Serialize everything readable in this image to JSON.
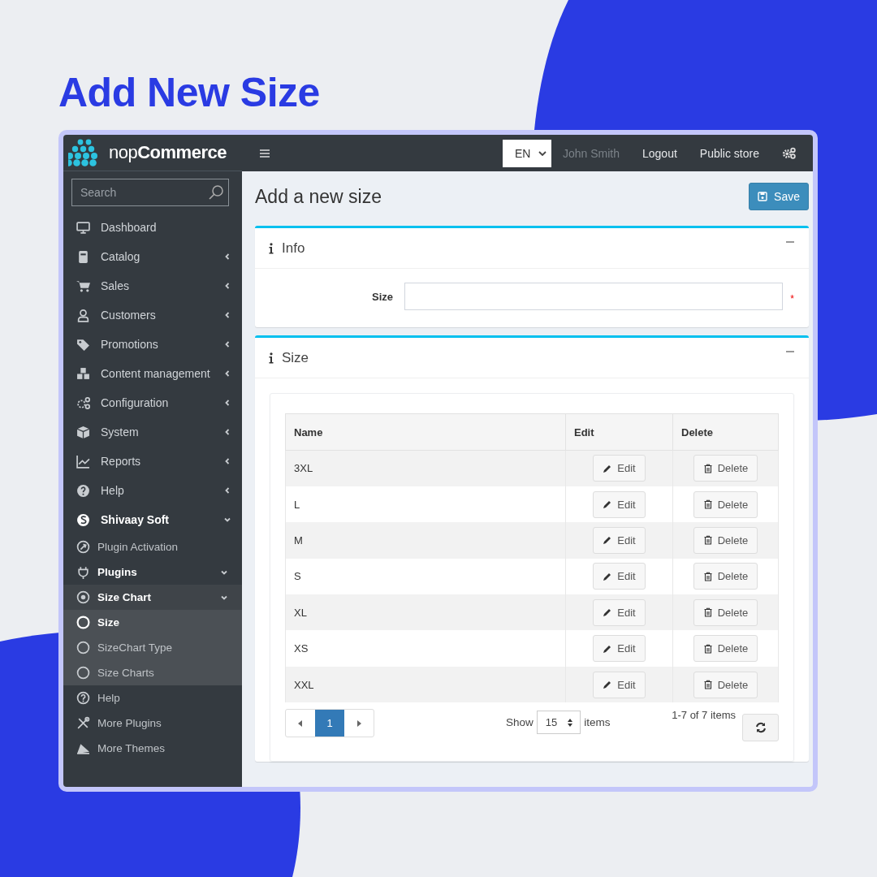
{
  "headline": "Add New Size",
  "logo": {
    "light": "nop",
    "bold": "Commerce"
  },
  "sidebar": {
    "search": {
      "placeholder": "Search"
    },
    "items": [
      {
        "label": "Dashboard",
        "kind": "link"
      },
      {
        "label": "Catalog",
        "kind": "group",
        "expanded": false
      },
      {
        "label": "Sales",
        "kind": "group",
        "expanded": false
      },
      {
        "label": "Customers",
        "kind": "group",
        "expanded": false
      },
      {
        "label": "Promotions",
        "kind": "group",
        "expanded": false
      },
      {
        "label": "Content management",
        "kind": "group",
        "expanded": false
      },
      {
        "label": "Configuration",
        "kind": "group",
        "expanded": false
      },
      {
        "label": "System",
        "kind": "group",
        "expanded": false
      },
      {
        "label": "Reports",
        "kind": "group",
        "expanded": false
      },
      {
        "label": "Help",
        "kind": "group",
        "expanded": false
      },
      {
        "label": "Shivaay Soft",
        "kind": "group",
        "expanded": true,
        "children": [
          {
            "label": "Plugin Activation",
            "kind": "link",
            "selected": false
          },
          {
            "label": "Plugins",
            "kind": "group",
            "expanded": true,
            "children": [
              {
                "label": "Size Chart",
                "kind": "group",
                "expanded": true,
                "children": [
                  {
                    "label": "Size",
                    "selected": true
                  },
                  {
                    "label": "SizeChart Type",
                    "selected": false
                  },
                  {
                    "label": "Size Charts",
                    "selected": false
                  }
                ]
              }
            ]
          },
          {
            "label": "Help",
            "kind": "link",
            "selected": false
          },
          {
            "label": "More Plugins",
            "kind": "link",
            "selected": false
          },
          {
            "label": "More Themes",
            "kind": "link",
            "selected": false
          }
        ]
      }
    ]
  },
  "topbar": {
    "language": "EN",
    "user": "John Smith",
    "links": [
      "Logout",
      "Public store"
    ]
  },
  "page": {
    "title": "Add a new size",
    "save_button": "Save"
  },
  "info_panel": {
    "title": "Info",
    "field_label": "Size",
    "required_mark": "*"
  },
  "size_panel": {
    "title": "Size",
    "table": {
      "columns": [
        "Name",
        "Edit",
        "Delete"
      ],
      "rows": [
        {
          "name": "3XL",
          "edit": "Edit",
          "delete": "Delete"
        },
        {
          "name": "L",
          "edit": "Edit",
          "delete": "Delete"
        },
        {
          "name": "M",
          "edit": "Edit",
          "delete": "Delete"
        },
        {
          "name": "S",
          "edit": "Edit",
          "delete": "Delete"
        },
        {
          "name": "XL",
          "edit": "Edit",
          "delete": "Delete"
        },
        {
          "name": "XS",
          "edit": "Edit",
          "delete": "Delete"
        },
        {
          "name": "XXL",
          "edit": "Edit",
          "delete": "Delete"
        }
      ]
    },
    "pager": {
      "pages": [
        {
          "label": "1",
          "selected": true
        }
      ],
      "show_label": "Show",
      "page_size": "15",
      "items_label": "items",
      "summary": "1-7 of 7 items"
    }
  }
}
